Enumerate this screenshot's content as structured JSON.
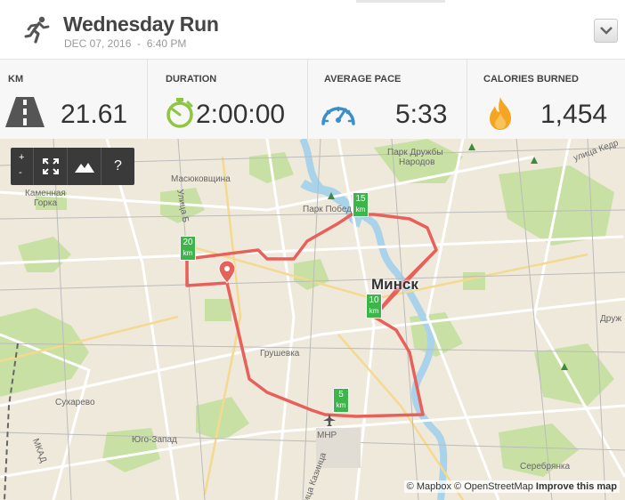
{
  "workout": {
    "title": "Wednesday Run",
    "date": "DEC 07, 2016",
    "time": "6:40 PM",
    "activity_icon": "runner-icon"
  },
  "stats": [
    {
      "label": "KM",
      "value": "21.61",
      "icon": "road-icon"
    },
    {
      "label": "DURATION",
      "value": "2:00:00",
      "icon": "stopwatch-icon"
    },
    {
      "label": "AVERAGE PACE",
      "value": "5:33",
      "icon": "speedometer-icon"
    },
    {
      "label": "CALORIES BURNED",
      "value": "1,454",
      "icon": "flame-icon"
    }
  ],
  "map": {
    "controls": {
      "zoom_in": "+",
      "zoom_out": "-",
      "help": "?"
    },
    "city_label": "Минск",
    "places": {
      "park_druzhby": "Парк Дружбы",
      "narodov": "Народов",
      "park_pobedy": "Парк Побед",
      "masyukovshchina": "Масюковщина",
      "kamennaya": "Каменная",
      "gorka": "Горка",
      "grushevka": "Грушевка",
      "sukharevo": "Сухарево",
      "yugo_zapad": "Юго-Запад",
      "serebryanka": "Серебрянка",
      "airport": "МНР",
      "street_kedy": "улица Кедр",
      "street_kazintsa": "улица Казинца",
      "mkad": "МКАД",
      "street_druzhba": "Друж",
      "street_ulitsa": "Улица Б"
    },
    "markers": [
      {
        "value": "15",
        "unit": "km"
      },
      {
        "value": "20",
        "unit": "km"
      },
      {
        "value": "10",
        "unit": "km"
      },
      {
        "value": "5",
        "unit": "km"
      }
    ],
    "attribution": {
      "mapbox": "© Mapbox",
      "osm": "© OpenStreetMap",
      "improve": "Improve this map"
    },
    "route_color": "#e8605a",
    "marker_color": "#3cb54a"
  }
}
